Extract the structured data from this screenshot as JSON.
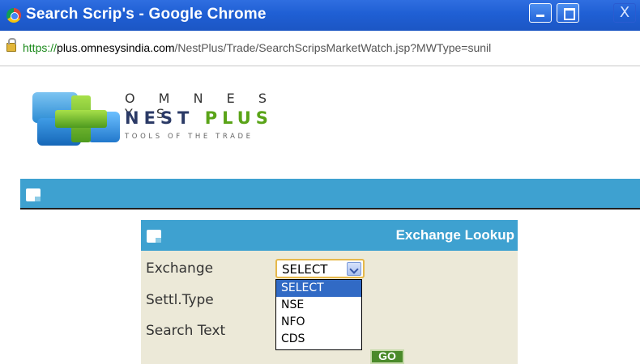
{
  "window": {
    "title": "Search Scrip's - Google Chrome",
    "close_label": "X"
  },
  "address_bar": {
    "scheme": "https://",
    "host": "plus.omnesysindia.com",
    "path": "/NestPlus/Trade/SearchScripsMarketWatch.jsp?MWType=sunil"
  },
  "logo": {
    "top": "O M N E S Y S",
    "nest": "NEST",
    "plus": "PLUS",
    "tagline": "TOOLS OF THE TRADE"
  },
  "panel": {
    "title": "Exchange Lookup",
    "labels": {
      "exchange": "Exchange",
      "settl_type": "Settl.Type",
      "search_text": "Search Text"
    },
    "exchange_select": {
      "value": "SELECT",
      "options": [
        "SELECT",
        "NSE",
        "NFO",
        "CDS"
      ],
      "highlighted": "SELECT"
    },
    "go_label": "GO"
  },
  "colors": {
    "titlebar": "#1f5fd4",
    "header_blue": "#3ea1d0",
    "panel_bg": "#ece9d8",
    "go_button": "#4a8a2a",
    "highlight": "#316ac5"
  }
}
